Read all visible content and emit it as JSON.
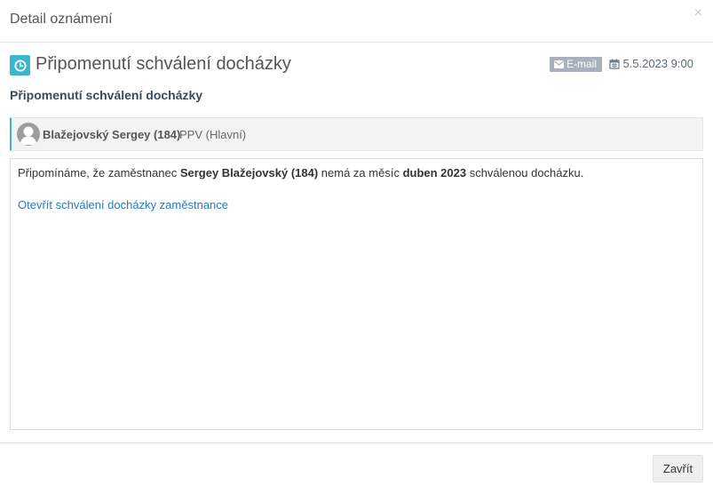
{
  "modal": {
    "title": "Detail oznámení",
    "close_symbol": "×"
  },
  "notification": {
    "icon": "clock-icon",
    "title": "Připomenutí schválení docházky",
    "channel_label": "E-mail",
    "date": "5.5.2023 9:00",
    "subtitle": "Připomenutí schválení docházky"
  },
  "person": {
    "name": "Blažejovský Sergey (184)",
    "department": "PPV (Hlavní)"
  },
  "message": {
    "part1": "Připomínáme, že zaměstnanec ",
    "employee": "Sergey Blažejovský (184)",
    "part2": " nemá za měsíc ",
    "period": "duben 2023",
    "part3": " schválenou docházku.",
    "link_text": "Otevřít schválení docházky zaměstnance"
  },
  "footer": {
    "close_label": "Zavřít"
  },
  "colors": {
    "accent": "#3bb6cf",
    "badge": "#a7b0bb",
    "link": "#2a7ab8"
  }
}
